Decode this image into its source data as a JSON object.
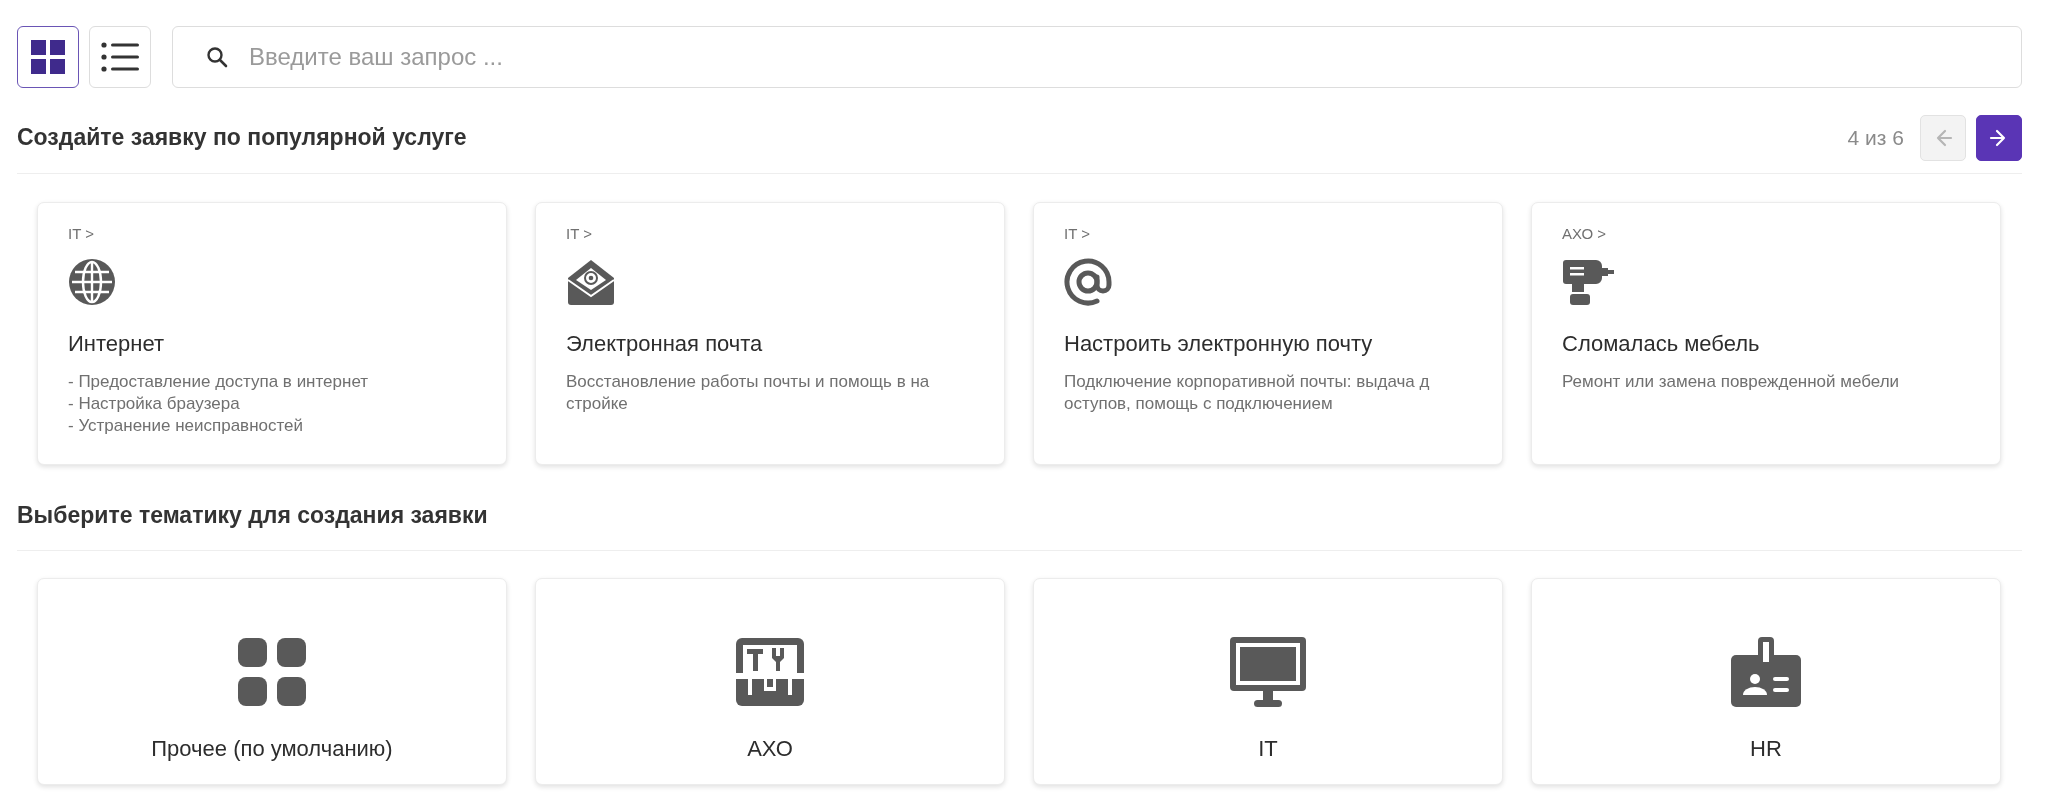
{
  "view_toggle": [
    {
      "kind": "grid",
      "selected": true
    },
    {
      "kind": "list",
      "selected": false
    }
  ],
  "search": {
    "placeholder": "Введите ваш запрос ..."
  },
  "popular": {
    "title": "Создайте заявку по популярной услуге",
    "pager": {
      "text": "4 из 6",
      "prev_disabled": true,
      "next_disabled": false
    },
    "cards": [
      {
        "category": "IT >",
        "title": "Интернет",
        "description_lines": [
          "- Предоставление доступа в интернет",
          "- Настройка браузера",
          "- Устранение неисправностей"
        ]
      },
      {
        "category": "IT >",
        "title": "Электронная почта",
        "description_lines": [
          "Восстановление работы почты и помощь в на",
          "стройке"
        ]
      },
      {
        "category": "IT >",
        "title": "Настроить электронную почту",
        "description_lines": [
          "Подключение корпоративной почты: выдача д",
          "оступов, помощь с подключением"
        ]
      },
      {
        "category": "АХО >",
        "title": "Сломалась мебель",
        "description_lines": [
          "Ремонт или замена поврежденной мебели"
        ]
      }
    ]
  },
  "topics": {
    "title": "Выберите тематику для создания заявки",
    "cards": [
      {
        "label": "Прочее (по умолчанию)"
      },
      {
        "label": "АХО"
      },
      {
        "label": "IT"
      },
      {
        "label": "HR"
      }
    ]
  }
}
